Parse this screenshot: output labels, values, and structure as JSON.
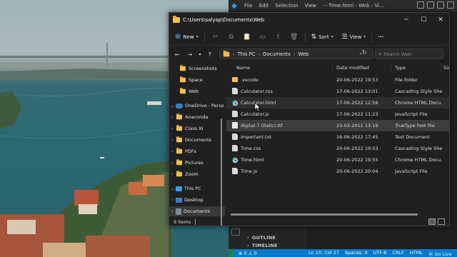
{
  "vscode": {
    "menu": [
      "File",
      "Edit",
      "Selection",
      "View",
      "···"
    ],
    "title": "Time.html - Web - Vi...",
    "panel": [
      "OUTLINE",
      "TIMELINE"
    ],
    "status": {
      "problems": "⊗ 0 ⚠ 0",
      "position": "Ln 10, Col 27",
      "spaces": "Spaces: 4",
      "encoding": "UTF-8",
      "eol": "CRLF",
      "language": "HTML",
      "golive": "⦿ Go Live"
    }
  },
  "explorer": {
    "title": "C:\\Users\\salyap\\Documents\\Web",
    "toolbar": {
      "new": "New",
      "sort": "Sort",
      "view": "View"
    },
    "breadcrumb": [
      "This PC",
      "Documents",
      "Web"
    ],
    "search_placeholder": "Search Web",
    "nav": [
      {
        "label": "Screenshots",
        "icon": "folder-icon"
      },
      {
        "label": "Space",
        "icon": "folder-icon"
      },
      {
        "label": "Web",
        "icon": "folder-icon"
      },
      {
        "label": "OneDrive - Perso",
        "icon": "cloud-icon"
      },
      {
        "label": "Anaconda",
        "icon": "folder-icon"
      },
      {
        "label": "Class XI",
        "icon": "folder-icon"
      },
      {
        "label": "Documents",
        "icon": "folder-icon"
      },
      {
        "label": "PDFs",
        "icon": "folder-icon"
      },
      {
        "label": "Pictures",
        "icon": "folder-icon"
      },
      {
        "label": "Zoom",
        "icon": "folder-icon"
      },
      {
        "label": "This PC",
        "icon": "pc-icon"
      },
      {
        "label": "Desktop",
        "icon": "desktop-icon"
      },
      {
        "label": "Documents",
        "icon": "documents-icon"
      }
    ],
    "columns": [
      "Name",
      "Date modified",
      "Type",
      "Siz"
    ],
    "files": [
      {
        "name": ".vscode",
        "date": "20-06-2022 19:53",
        "type": "File folder",
        "icon": "folder"
      },
      {
        "name": "Calculator.css",
        "date": "17-06-2022 13:01",
        "type": "Cascading Style Shee...",
        "icon": "doc"
      },
      {
        "name": "Calculator.html",
        "date": "17-06-2022 12:56",
        "type": "Chrome HTML Docu...",
        "icon": "chrome"
      },
      {
        "name": "Calculator.js",
        "date": "17-06-2022 11:23",
        "type": "JavaScript File",
        "icon": "doc"
      },
      {
        "name": "digital-7 (italic).ttf",
        "date": "23-03-2011 13:19",
        "type": "TrueType font file",
        "icon": "font"
      },
      {
        "name": "important.txt",
        "date": "16-06-2022 17:45",
        "type": "Text Document",
        "icon": "doc"
      },
      {
        "name": "Time.css",
        "date": "20-06-2022 19:53",
        "type": "Cascading Style Shee...",
        "icon": "doc"
      },
      {
        "name": "Time.html",
        "date": "20-06-2022 19:55",
        "type": "Chrome HTML Docu...",
        "icon": "chrome"
      },
      {
        "name": "Time.js",
        "date": "20-06-2022 20:04",
        "type": "JavaScript File",
        "icon": "doc"
      }
    ],
    "item_count": "9 items"
  }
}
